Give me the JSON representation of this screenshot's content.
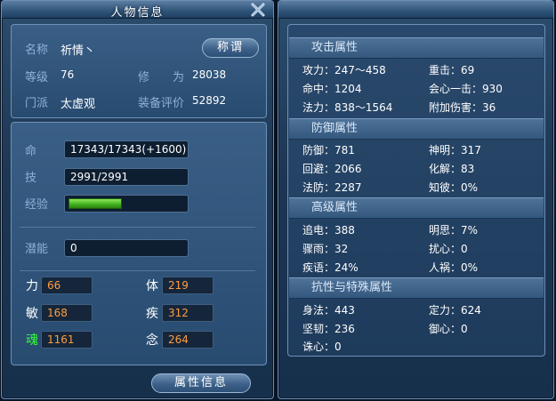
{
  "left_window": {
    "title": "人物信息",
    "basic": {
      "name_label": "名称",
      "name_value": "祈情丶",
      "title_button": "称谓",
      "level_label": "等级",
      "level_value": "76",
      "cultivation_label": "修　　为",
      "cultivation_value": "28038",
      "sect_label": "门派",
      "sect_value": "太虚观",
      "gear_label": "装备评价",
      "gear_value": "52892"
    },
    "bars": {
      "hp_label": "命",
      "hp_value": "17343/17343(+1600)",
      "skill_label": "技",
      "skill_value": "2991/2991",
      "exp_label": "经验",
      "exp_fraction": 0.46,
      "potential_label": "潜能",
      "potential_value": "0"
    },
    "attributes": [
      {
        "label": "力",
        "value": "66"
      },
      {
        "label": "体",
        "value": "219"
      },
      {
        "label": "敏",
        "value": "168"
      },
      {
        "label": "疾",
        "value": "312"
      },
      {
        "label": "魂",
        "value": "1161"
      },
      {
        "label": "念",
        "value": "264"
      }
    ],
    "bottom_button": "属性信息"
  },
  "right_window": {
    "sections": [
      {
        "title": "攻击属性",
        "items": [
          {
            "text": "攻力：247～458"
          },
          {
            "text": "重击：69"
          },
          {
            "text": "命中：1204"
          },
          {
            "text": "会心一击：930"
          },
          {
            "text": "法力：838～1564"
          },
          {
            "text": "附加伤害：36"
          }
        ]
      },
      {
        "title": "防御属性",
        "items": [
          {
            "text": "防御：781"
          },
          {
            "text": "神明：317"
          },
          {
            "text": "回避：2066"
          },
          {
            "text": "化解：83"
          },
          {
            "text": "法防：2287"
          },
          {
            "text": "知彼：0%"
          }
        ]
      },
      {
        "title": "高级属性",
        "items": [
          {
            "text": "追电：388"
          },
          {
            "text": "明思：7%"
          },
          {
            "text": "骤雨：32"
          },
          {
            "text": "扰心：0"
          },
          {
            "text": "疾语：24%"
          },
          {
            "text": "人祸：0%"
          }
        ]
      },
      {
        "title": "抗性与特殊属性",
        "items": [
          {
            "text": "身法：443"
          },
          {
            "text": "定力：624"
          },
          {
            "text": "坚韧：236"
          },
          {
            "text": "御心：0"
          },
          {
            "text": "诛心：0"
          }
        ]
      }
    ]
  },
  "colors": {
    "label_blue": "#8fb1d8",
    "attr_value_orange": "#ff9d3c",
    "soul_green": "#33ff33",
    "exp_green": "#3fae1e"
  },
  "icons": {
    "close": "close-icon"
  }
}
